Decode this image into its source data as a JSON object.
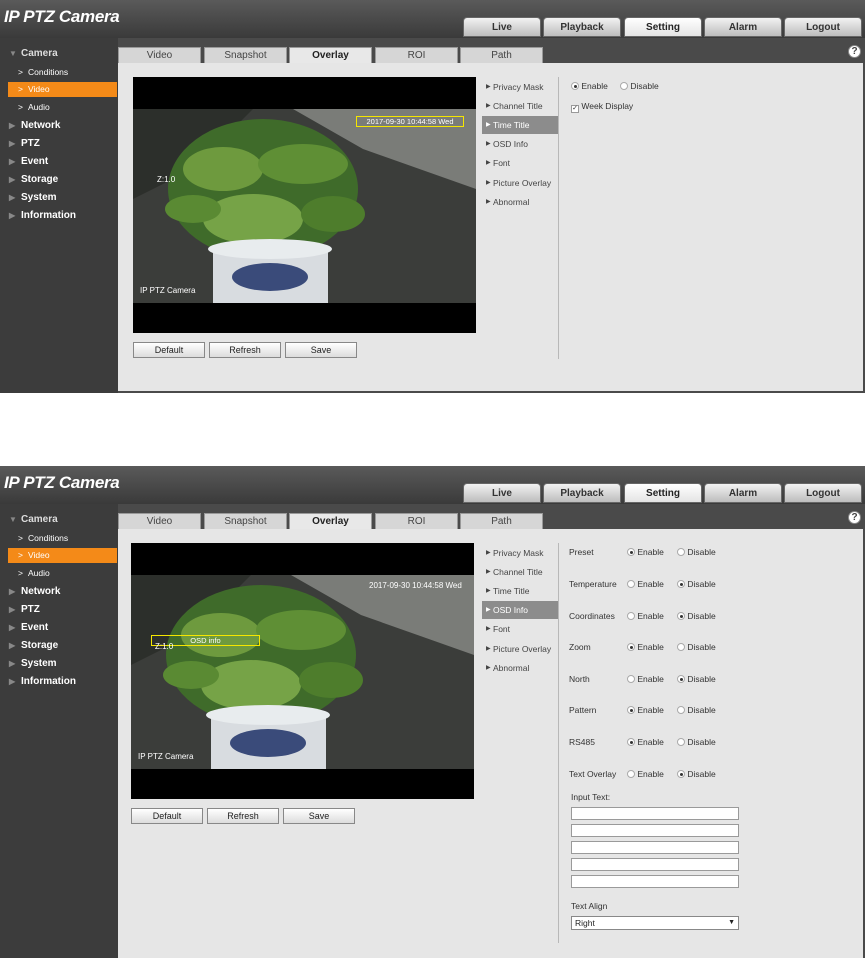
{
  "app": {
    "title": "IP PTZ Camera"
  },
  "topnav": [
    "Live",
    "Playback",
    "Setting",
    "Alarm",
    "Logout"
  ],
  "topnav_active": "Setting",
  "sidebar": {
    "camera": "Camera",
    "camera_children": [
      "Conditions",
      "Video",
      "Audio"
    ],
    "active_child": "Video",
    "items": [
      "Network",
      "PTZ",
      "Event",
      "Storage",
      "System",
      "Information"
    ]
  },
  "tabs": [
    "Video",
    "Snapshot",
    "Overlay",
    "ROI",
    "Path"
  ],
  "active_tab": "Overlay",
  "help": "?",
  "video": {
    "camera_name": "IP PTZ Camera",
    "zoom_label": "Z:1.0",
    "timestamp": "2017-09-30 10:44:58 Wed",
    "osd_info_box": "OSD info"
  },
  "buttons": {
    "default": "Default",
    "refresh": "Refresh",
    "save": "Save"
  },
  "overlay_menu": [
    "Privacy Mask",
    "Channel Title",
    "Time Title",
    "OSD Info",
    "Font",
    "Picture Overlay",
    "Abnormal"
  ],
  "screenshot1": {
    "active_menu": "Time Title",
    "enable": "Enable",
    "disable": "Disable",
    "enable_selected": true,
    "week_display": "Week Display",
    "week_display_checked": true
  },
  "screenshot2": {
    "active_menu": "OSD Info",
    "enable": "Enable",
    "disable": "Disable",
    "options": [
      {
        "label": "Preset",
        "enabled": true
      },
      {
        "label": "Temperature",
        "enabled": false
      },
      {
        "label": "Coordinates",
        "enabled": false
      },
      {
        "label": "Zoom",
        "enabled": true
      },
      {
        "label": "North",
        "enabled": false
      },
      {
        "label": "Pattern",
        "enabled": true
      },
      {
        "label": "RS485",
        "enabled": true
      },
      {
        "label": "Text Overlay",
        "enabled": false
      }
    ],
    "input_text_label": "Input Text:",
    "input_text_values": [
      "",
      "",
      "",
      "",
      ""
    ],
    "text_align_label": "Text Align",
    "text_align_value": "Right"
  },
  "colors": {
    "accent": "#f48a18",
    "sidebar": "#3c3c3c",
    "panel": "#e6e6e6",
    "osd_box": "#f5e600"
  }
}
